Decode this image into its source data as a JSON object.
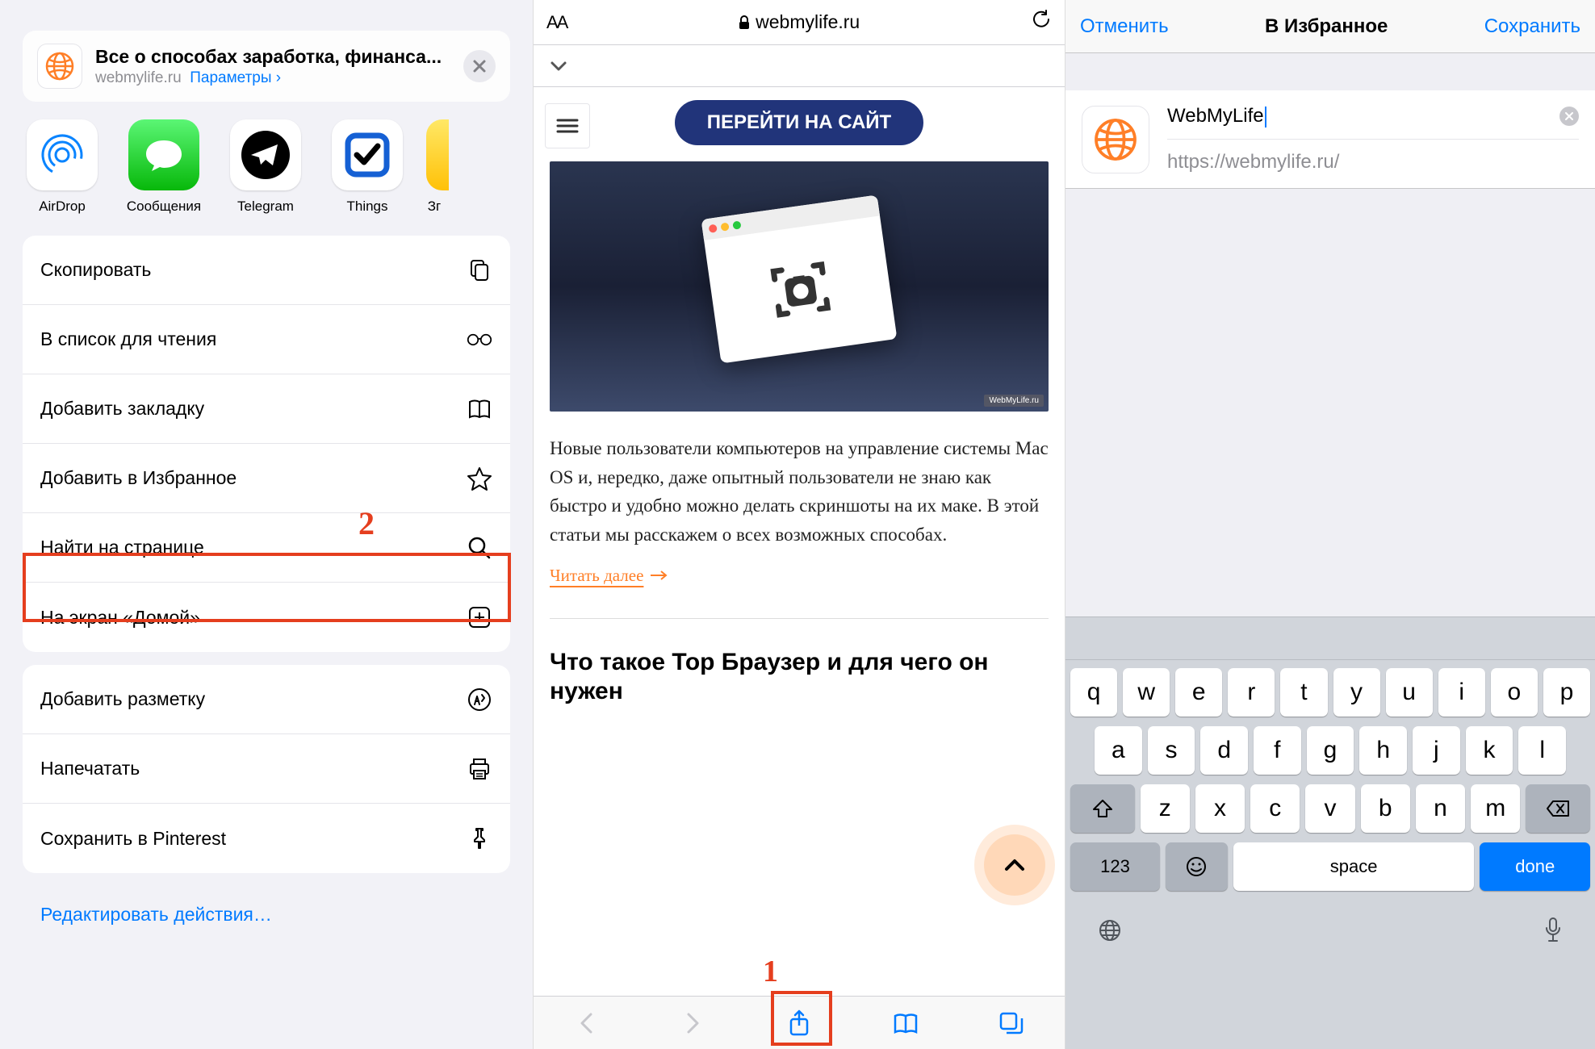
{
  "panel1": {
    "card": {
      "title": "Все о способах заработка, финанса...",
      "domain": "webmylife.ru",
      "options": "Параметры",
      "options_arrow": "›"
    },
    "apps": [
      {
        "label": "AirDrop"
      },
      {
        "label": "Сообщения"
      },
      {
        "label": "Telegram"
      },
      {
        "label": "Things"
      },
      {
        "label": "Зг"
      }
    ],
    "actions1": [
      {
        "label": "Скопировать",
        "icon": "copy"
      },
      {
        "label": "В список для чтения",
        "icon": "glasses"
      },
      {
        "label": "Добавить закладку",
        "icon": "book"
      },
      {
        "label": "Добавить в Избранное",
        "icon": "star"
      },
      {
        "label": "Найти на странице",
        "icon": "search"
      },
      {
        "label": "На экран «Домой»",
        "icon": "plus-square"
      }
    ],
    "actions2": [
      {
        "label": "Добавить разметку",
        "icon": "markup"
      },
      {
        "label": "Напечатать",
        "icon": "print"
      },
      {
        "label": "Сохранить в Pinterest",
        "icon": "pin"
      }
    ],
    "edit": "Редактировать действия…",
    "annotation": "2"
  },
  "panel2": {
    "url": "webmylife.ru",
    "cta": "ПЕРЕЙТИ НА САЙТ",
    "watermark": "WebMyLife.ru",
    "text": "Новые пользователи компьютеров на управление системы Mac OS и, нередко, даже опытный пользователи не знаю как быстро и удобно можно делать скриншоты на их маке. В этой статьи мы расскажем о всех возможных способах.",
    "readmore": "Читать далее",
    "h2": "Что такое Тор Браузер и для чего он нужен",
    "annotation": "1"
  },
  "panel3": {
    "cancel": "Отменить",
    "title": "В Избранное",
    "save": "Сохранить",
    "name_value": "WebMyLife",
    "url_value": "https://webmylife.ru/",
    "keys_row1": [
      "q",
      "w",
      "e",
      "r",
      "t",
      "y",
      "u",
      "i",
      "o",
      "p"
    ],
    "keys_row2": [
      "a",
      "s",
      "d",
      "f",
      "g",
      "h",
      "j",
      "k",
      "l"
    ],
    "keys_row3": [
      "z",
      "x",
      "c",
      "v",
      "b",
      "n",
      "m"
    ],
    "key_num": "123",
    "key_space": "space",
    "key_done": "done"
  }
}
